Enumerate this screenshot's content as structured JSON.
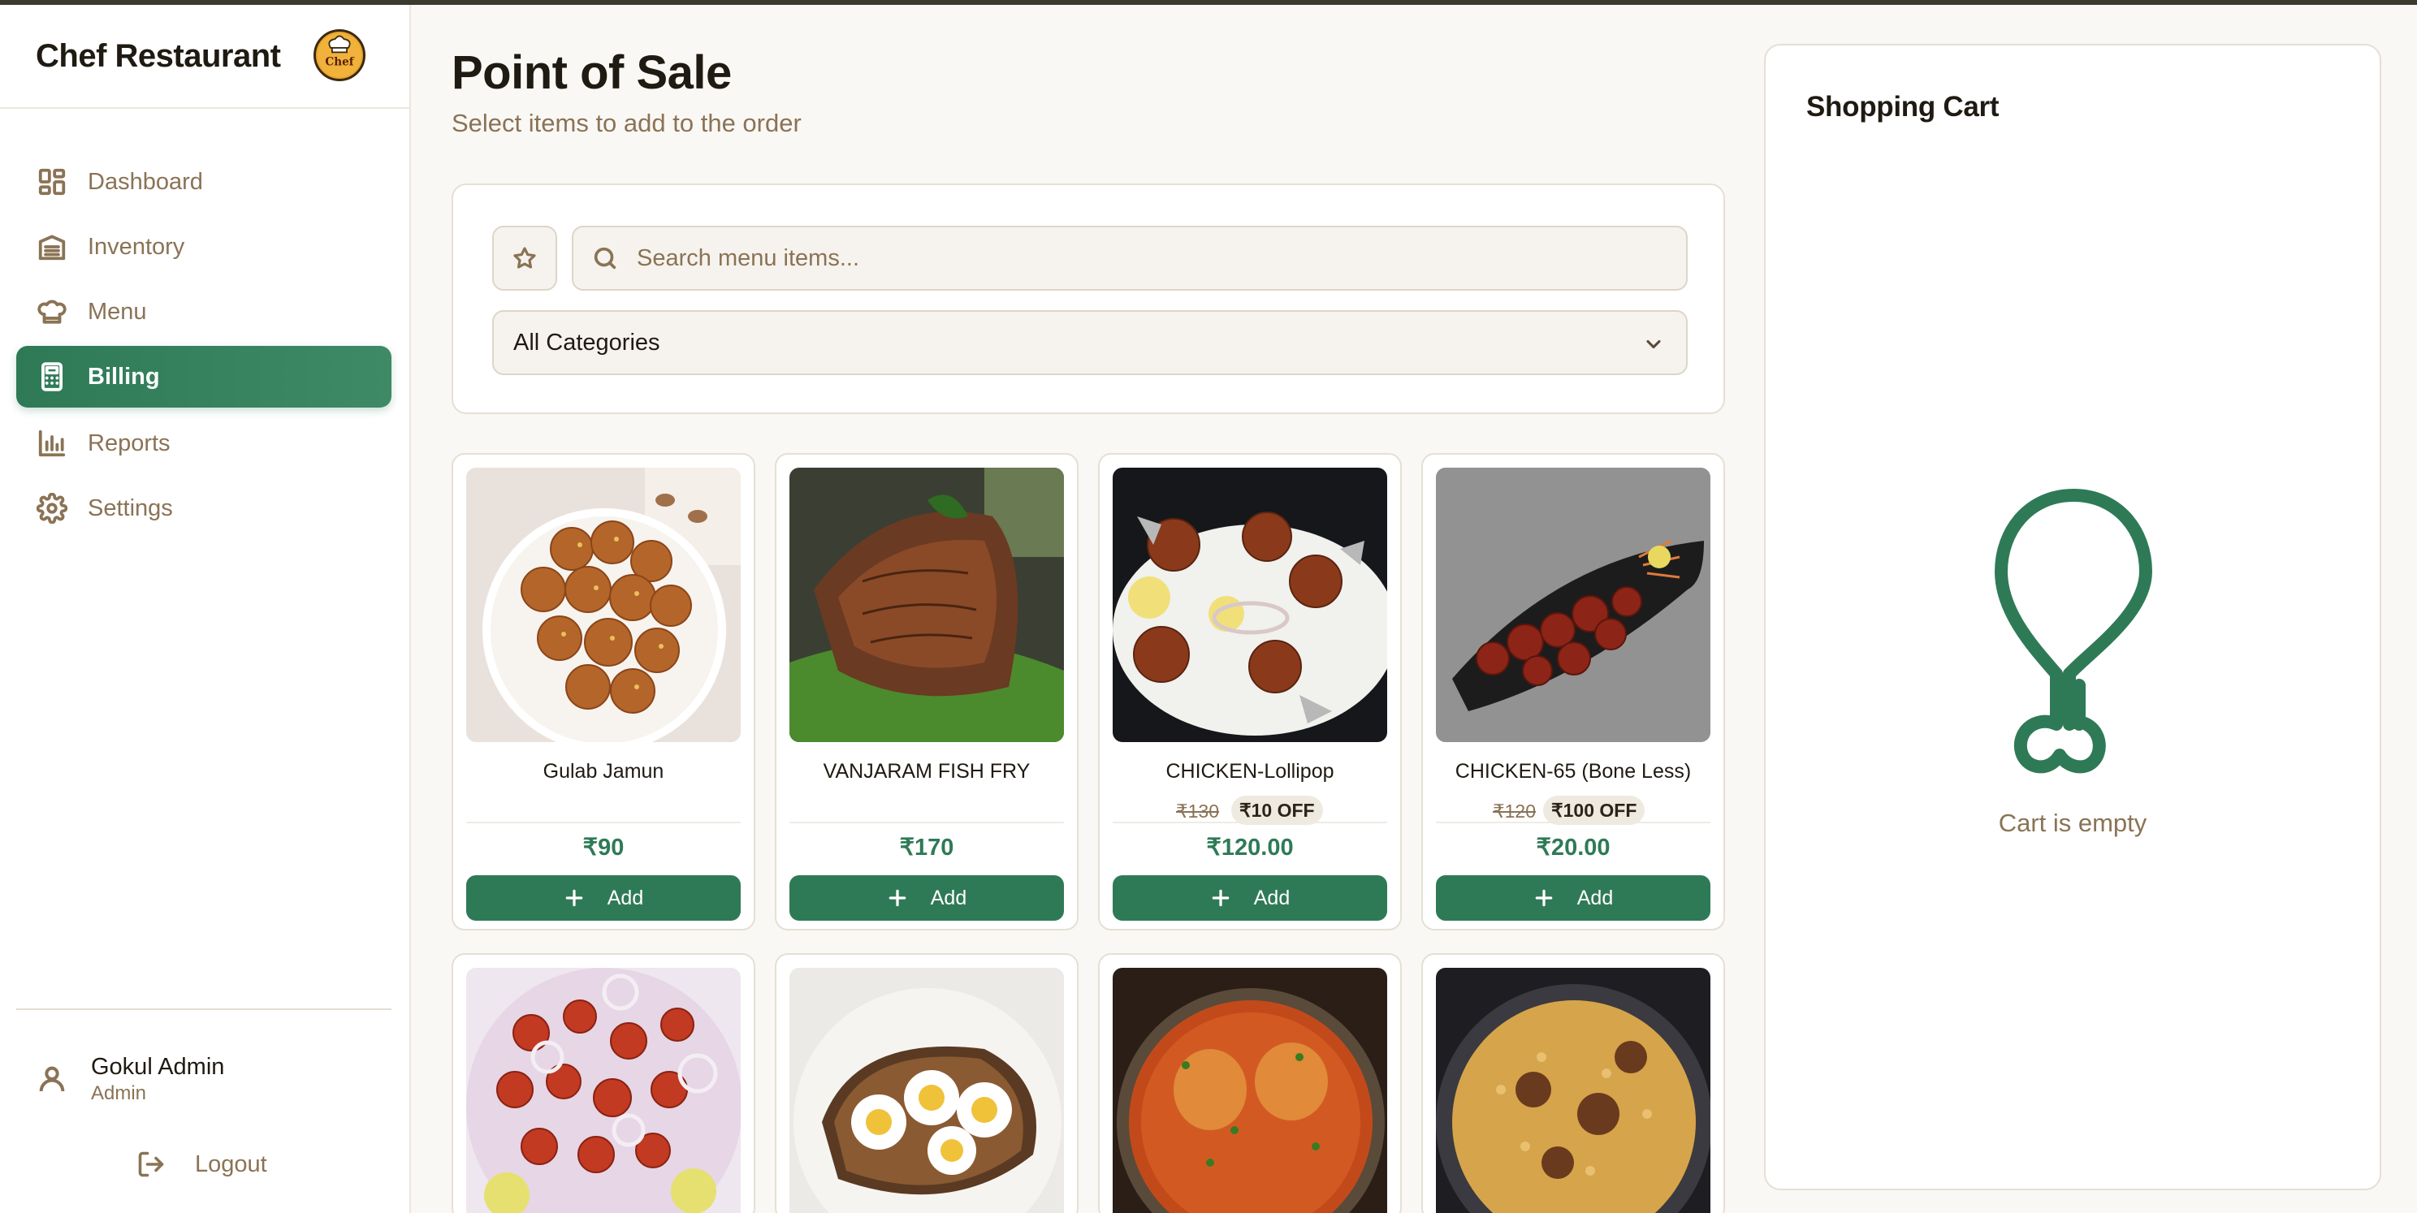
{
  "app": {
    "name": "Chef Restaurant",
    "logo_text": "Chef"
  },
  "sidebar": {
    "items": [
      {
        "label": "Dashboard",
        "icon": "dashboard-icon",
        "active": false
      },
      {
        "label": "Inventory",
        "icon": "warehouse-icon",
        "active": false
      },
      {
        "label": "Menu",
        "icon": "chef-hat-icon",
        "active": false
      },
      {
        "label": "Billing",
        "icon": "calculator-icon",
        "active": true
      },
      {
        "label": "Reports",
        "icon": "bar-chart-icon",
        "active": false
      },
      {
        "label": "Settings",
        "icon": "gear-icon",
        "active": false
      }
    ],
    "user": {
      "name": "Gokul Admin",
      "role": "Admin"
    },
    "logout_label": "Logout"
  },
  "header": {
    "title": "Point of Sale",
    "subtitle": "Select items to add to the order"
  },
  "filters": {
    "search_placeholder": "Search menu items...",
    "category_selected": "All Categories"
  },
  "products": [
    {
      "name": "Gulab Jamun",
      "price": "₹90",
      "original_price": "",
      "discount": "",
      "add_label": "Add"
    },
    {
      "name": "VANJARAM FISH FRY",
      "price": "₹170",
      "original_price": "",
      "discount": "",
      "add_label": "Add"
    },
    {
      "name": "CHICKEN-Lollipop",
      "price": "₹120.00",
      "original_price": "₹130",
      "discount": "₹10 OFF",
      "add_label": "Add"
    },
    {
      "name": "CHICKEN-65 (Bone Less)",
      "price": "₹20.00",
      "original_price": "₹120",
      "discount": "₹100 OFF",
      "add_label": "Add"
    }
  ],
  "cart": {
    "title": "Shopping Cart",
    "empty_text": "Cart is empty"
  },
  "colors": {
    "accent": "#2f7a56",
    "muted_text": "#8a7355",
    "background": "#faf8f5"
  }
}
